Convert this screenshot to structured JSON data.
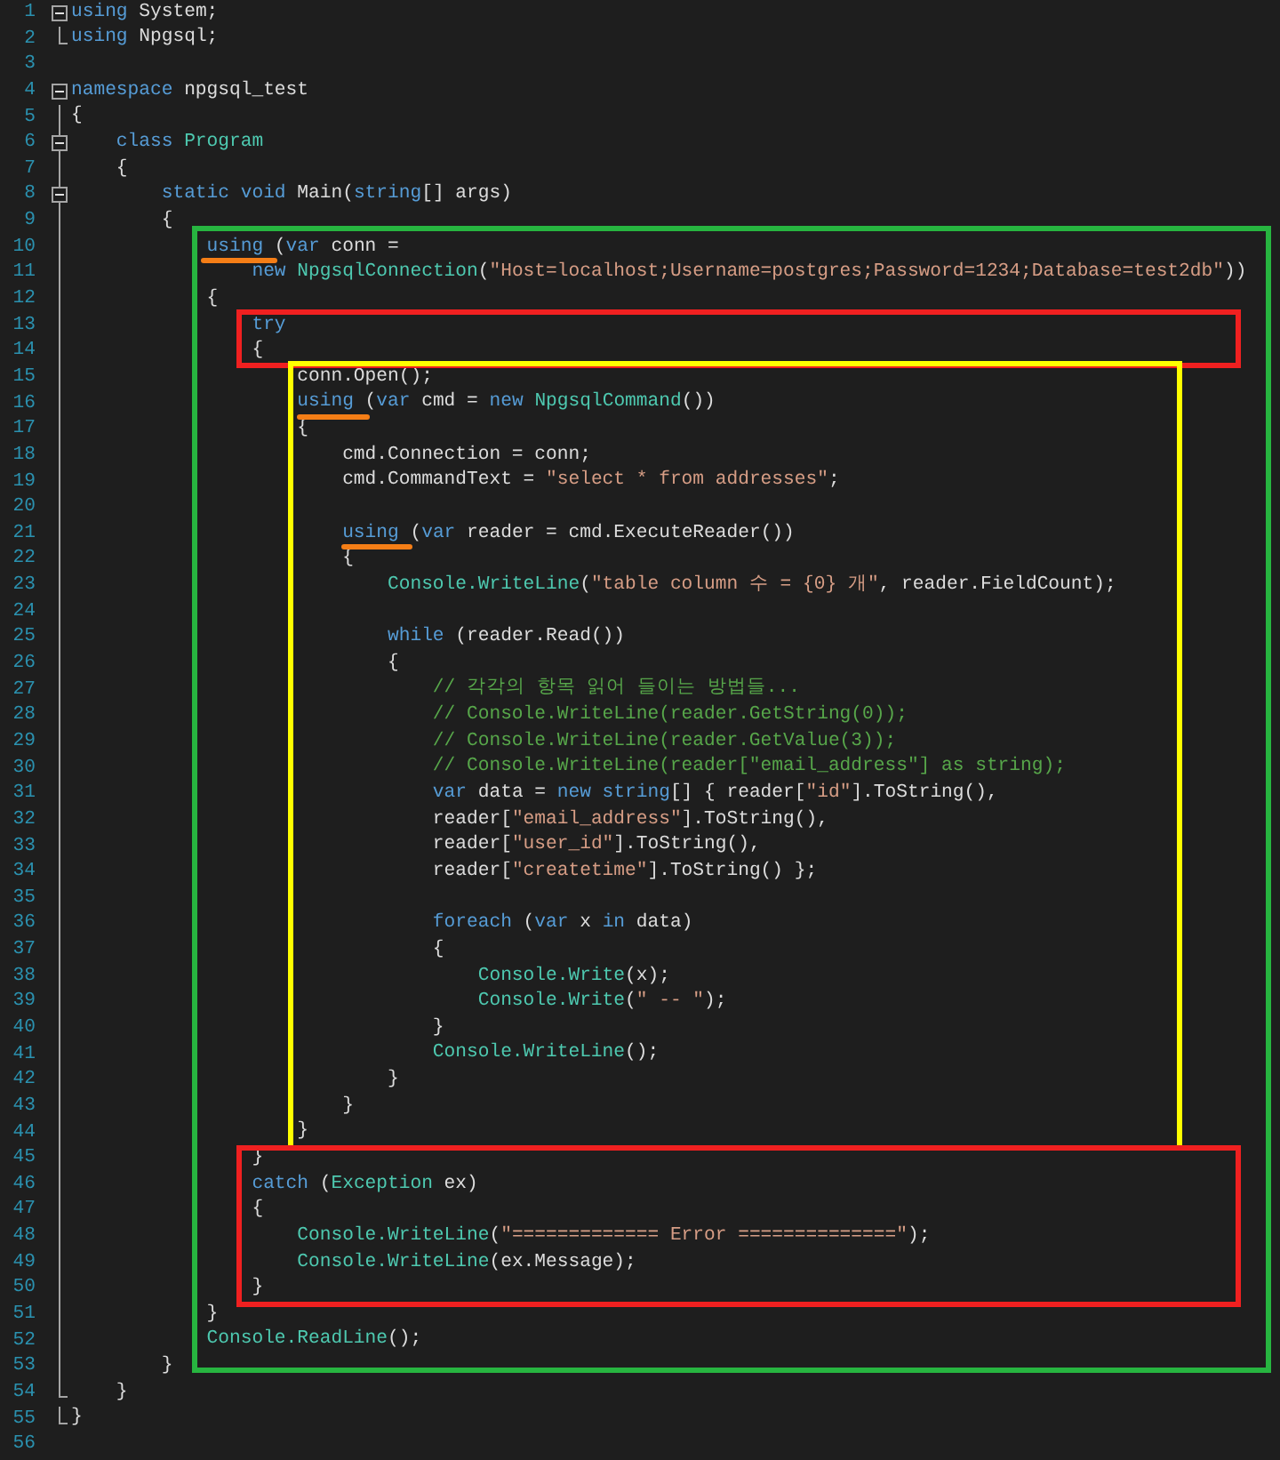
{
  "editor": {
    "lines": [
      {
        "number": "1",
        "kind": "fold-start",
        "expanded": true,
        "tokens": [
          {
            "kind": "kw",
            "text": "using"
          },
          {
            "kind": "plain",
            "text": " System;"
          }
        ]
      },
      {
        "number": "2",
        "kind": "fold-end",
        "tokens": [
          {
            "kind": "kw",
            "text": "using"
          },
          {
            "kind": "plain",
            "text": " Npgsql;"
          }
        ]
      },
      {
        "number": "3",
        "kind": "bare"
      },
      {
        "number": "4",
        "kind": "fold-start",
        "expanded": true,
        "tokens": [
          {
            "kind": "kw",
            "text": "namespace"
          },
          {
            "kind": "plain",
            "text": " npgsql_test"
          }
        ]
      },
      {
        "number": "5",
        "kind": "guide",
        "tokens": [
          {
            "kind": "plain",
            "text": "{"
          }
        ]
      },
      {
        "number": "6",
        "kind": "fold-start",
        "expanded": true,
        "tokens": [
          {
            "kind": "kw",
            "text": "    class "
          },
          {
            "kind": "type",
            "text": "Program"
          }
        ]
      },
      {
        "number": "7",
        "kind": "guide",
        "tokens": [
          {
            "kind": "plain",
            "text": "    {"
          }
        ]
      },
      {
        "number": "8",
        "kind": "fold-start",
        "expanded": true,
        "tokens": [
          {
            "kind": "kw",
            "text": "        static void"
          },
          {
            "kind": "plain",
            "text": " Main("
          },
          {
            "kind": "kw",
            "text": "string"
          },
          {
            "kind": "plain",
            "text": "[] args)"
          }
        ]
      },
      {
        "number": "9",
        "kind": "guide",
        "tokens": [
          {
            "kind": "plain",
            "text": "        {"
          }
        ]
      },
      {
        "number": "10",
        "kind": "guide",
        "tokens": [
          {
            "kind": "kw",
            "text": "            using"
          },
          {
            "kind": "plain",
            "text": " ("
          },
          {
            "kind": "kw",
            "text": "var"
          },
          {
            "kind": "plain",
            "text": " conn ="
          }
        ]
      },
      {
        "number": "11",
        "kind": "guide",
        "tokens": [
          {
            "kind": "kw",
            "text": "                new "
          },
          {
            "kind": "type",
            "text": "NpgsqlConnection"
          },
          {
            "kind": "plain",
            "text": "("
          },
          {
            "kind": "str",
            "text": "\"Host=localhost;Username=postgres;Password=1234;Database=test2db\""
          },
          {
            "kind": "plain",
            "text": "))"
          }
        ]
      },
      {
        "number": "12",
        "kind": "guide",
        "tokens": [
          {
            "kind": "plain",
            "text": "            {"
          }
        ]
      },
      {
        "number": "13",
        "kind": "guide",
        "tokens": [
          {
            "kind": "kw",
            "text": "                try"
          }
        ]
      },
      {
        "number": "14",
        "kind": "guide",
        "tokens": [
          {
            "kind": "plain",
            "text": "                {"
          }
        ]
      },
      {
        "number": "15",
        "kind": "guide",
        "tokens": [
          {
            "kind": "plain",
            "text": "                    conn.Open();"
          }
        ]
      },
      {
        "number": "16",
        "kind": "guide",
        "tokens": [
          {
            "kind": "kw",
            "text": "                    using"
          },
          {
            "kind": "plain",
            "text": " ("
          },
          {
            "kind": "kw",
            "text": "var"
          },
          {
            "kind": "plain",
            "text": " cmd = "
          },
          {
            "kind": "kw",
            "text": "new "
          },
          {
            "kind": "type",
            "text": "NpgsqlCommand"
          },
          {
            "kind": "plain",
            "text": "())"
          }
        ]
      },
      {
        "number": "17",
        "kind": "guide",
        "tokens": [
          {
            "kind": "plain",
            "text": "                    {"
          }
        ]
      },
      {
        "number": "18",
        "kind": "guide",
        "tokens": [
          {
            "kind": "plain",
            "text": "                        cmd.Connection = conn;"
          }
        ]
      },
      {
        "number": "19",
        "kind": "guide",
        "tokens": [
          {
            "kind": "plain",
            "text": "                        cmd.CommandText = "
          },
          {
            "kind": "str",
            "text": "\"select * from addresses\""
          },
          {
            "kind": "plain",
            "text": ";"
          }
        ]
      },
      {
        "number": "20",
        "kind": "guide"
      },
      {
        "number": "21",
        "kind": "guide",
        "tokens": [
          {
            "kind": "kw",
            "text": "                        using"
          },
          {
            "kind": "plain",
            "text": " ("
          },
          {
            "kind": "kw",
            "text": "var"
          },
          {
            "kind": "plain",
            "text": " reader = cmd.ExecuteReader())"
          }
        ]
      },
      {
        "number": "22",
        "kind": "guide",
        "tokens": [
          {
            "kind": "plain",
            "text": "                        {"
          }
        ]
      },
      {
        "number": "23",
        "kind": "guide",
        "tokens": [
          {
            "kind": "type",
            "text": "                            Console.WriteLine"
          },
          {
            "kind": "plain",
            "text": "("
          },
          {
            "kind": "str",
            "text": "\"table column 수 = {0} 개\""
          },
          {
            "kind": "plain",
            "text": ", reader.FieldCount);"
          }
        ]
      },
      {
        "number": "24",
        "kind": "guide"
      },
      {
        "number": "25",
        "kind": "guide",
        "tokens": [
          {
            "kind": "kw",
            "text": "                            while"
          },
          {
            "kind": "plain",
            "text": " (reader.Read())"
          }
        ]
      },
      {
        "number": "26",
        "kind": "guide",
        "tokens": [
          {
            "kind": "plain",
            "text": "                            {"
          }
        ]
      },
      {
        "number": "27",
        "kind": "guide",
        "tokens": [
          {
            "kind": "cmt",
            "text": "                                // 각각의 항목 읽어 들이는 방법들..."
          }
        ]
      },
      {
        "number": "28",
        "kind": "guide",
        "tokens": [
          {
            "kind": "cmt",
            "text": "                                // Console.WriteLine(reader.GetString(0));"
          }
        ]
      },
      {
        "number": "29",
        "kind": "guide",
        "tokens": [
          {
            "kind": "cmt",
            "text": "                                // Console.WriteLine(reader.GetValue(3));"
          }
        ]
      },
      {
        "number": "30",
        "kind": "guide",
        "tokens": [
          {
            "kind": "cmt",
            "text": "                                // Console.WriteLine(reader[\"email_address\"] as string);"
          }
        ]
      },
      {
        "number": "31",
        "kind": "guide",
        "tokens": [
          {
            "kind": "kw",
            "text": "                                var"
          },
          {
            "kind": "plain",
            "text": " data = "
          },
          {
            "kind": "kw",
            "text": "new string"
          },
          {
            "kind": "plain",
            "text": "[] { reader["
          },
          {
            "kind": "str",
            "text": "\"id\""
          },
          {
            "kind": "plain",
            "text": "].ToString(),"
          }
        ]
      },
      {
        "number": "32",
        "kind": "guide",
        "tokens": [
          {
            "kind": "plain",
            "text": "                                reader["
          },
          {
            "kind": "str",
            "text": "\"email_address\""
          },
          {
            "kind": "plain",
            "text": "].ToString(),"
          }
        ]
      },
      {
        "number": "33",
        "kind": "guide",
        "tokens": [
          {
            "kind": "plain",
            "text": "                                reader["
          },
          {
            "kind": "str",
            "text": "\"user_id\""
          },
          {
            "kind": "plain",
            "text": "].ToString(),"
          }
        ]
      },
      {
        "number": "34",
        "kind": "guide",
        "tokens": [
          {
            "kind": "plain",
            "text": "                                reader["
          },
          {
            "kind": "str",
            "text": "\"createtime\""
          },
          {
            "kind": "plain",
            "text": "].ToString() };"
          }
        ]
      },
      {
        "number": "35",
        "kind": "guide"
      },
      {
        "number": "36",
        "kind": "guide",
        "tokens": [
          {
            "kind": "kw",
            "text": "                                foreach"
          },
          {
            "kind": "plain",
            "text": " ("
          },
          {
            "kind": "kw",
            "text": "var"
          },
          {
            "kind": "plain",
            "text": " x "
          },
          {
            "kind": "kw",
            "text": "in"
          },
          {
            "kind": "plain",
            "text": " data)"
          }
        ]
      },
      {
        "number": "37",
        "kind": "guide",
        "tokens": [
          {
            "kind": "plain",
            "text": "                                {"
          }
        ]
      },
      {
        "number": "38",
        "kind": "guide",
        "tokens": [
          {
            "kind": "type",
            "text": "                                    Console.Write"
          },
          {
            "kind": "plain",
            "text": "(x);"
          }
        ]
      },
      {
        "number": "39",
        "kind": "guide",
        "tokens": [
          {
            "kind": "type",
            "text": "                                    Console.Write"
          },
          {
            "kind": "plain",
            "text": "("
          },
          {
            "kind": "str",
            "text": "\" -- \""
          },
          {
            "kind": "plain",
            "text": ");"
          }
        ]
      },
      {
        "number": "40",
        "kind": "guide",
        "tokens": [
          {
            "kind": "plain",
            "text": "                                }"
          }
        ]
      },
      {
        "number": "41",
        "kind": "guide",
        "tokens": [
          {
            "kind": "type",
            "text": "                                Console.WriteLine"
          },
          {
            "kind": "plain",
            "text": "();"
          }
        ]
      },
      {
        "number": "42",
        "kind": "guide",
        "tokens": [
          {
            "kind": "plain",
            "text": "                            }"
          }
        ]
      },
      {
        "number": "43",
        "kind": "guide",
        "tokens": [
          {
            "kind": "plain",
            "text": "                        }"
          }
        ]
      },
      {
        "number": "44",
        "kind": "guide",
        "tokens": [
          {
            "kind": "plain",
            "text": "                    }"
          }
        ]
      },
      {
        "number": "45",
        "kind": "guide",
        "tokens": [
          {
            "kind": "plain",
            "text": "                }"
          }
        ]
      },
      {
        "number": "46",
        "kind": "guide",
        "tokens": [
          {
            "kind": "kw",
            "text": "                catch"
          },
          {
            "kind": "plain",
            "text": " ("
          },
          {
            "kind": "type",
            "text": "Exception"
          },
          {
            "kind": "plain",
            "text": " ex)"
          }
        ]
      },
      {
        "number": "47",
        "kind": "guide",
        "tokens": [
          {
            "kind": "plain",
            "text": "                {"
          }
        ]
      },
      {
        "number": "48",
        "kind": "guide",
        "tokens": [
          {
            "kind": "type",
            "text": "                    Console.WriteLine"
          },
          {
            "kind": "plain",
            "text": "("
          },
          {
            "kind": "str",
            "text": "\"============= Error ==============\""
          },
          {
            "kind": "plain",
            "text": ");"
          }
        ]
      },
      {
        "number": "49",
        "kind": "guide",
        "tokens": [
          {
            "kind": "type",
            "text": "                    Console.WriteLine"
          },
          {
            "kind": "plain",
            "text": "(ex.Message);"
          }
        ]
      },
      {
        "number": "50",
        "kind": "guide",
        "tokens": [
          {
            "kind": "plain",
            "text": "                }"
          }
        ]
      },
      {
        "number": "51",
        "kind": "guide",
        "tokens": [
          {
            "kind": "plain",
            "text": "            }"
          }
        ]
      },
      {
        "number": "52",
        "kind": "guide",
        "tokens": [
          {
            "kind": "type",
            "text": "            Console.ReadLine"
          },
          {
            "kind": "plain",
            "text": "();"
          }
        ]
      },
      {
        "number": "53",
        "kind": "guide",
        "tokens": [
          {
            "kind": "plain",
            "text": "        }"
          }
        ]
      },
      {
        "number": "54",
        "kind": "fold-end",
        "tokens": [
          {
            "kind": "plain",
            "text": "    }"
          }
        ]
      },
      {
        "number": "55",
        "kind": "fold-end",
        "tokens": [
          {
            "kind": "plain",
            "text": "}"
          }
        ]
      },
      {
        "number": "56",
        "kind": "bare"
      }
    ]
  }
}
